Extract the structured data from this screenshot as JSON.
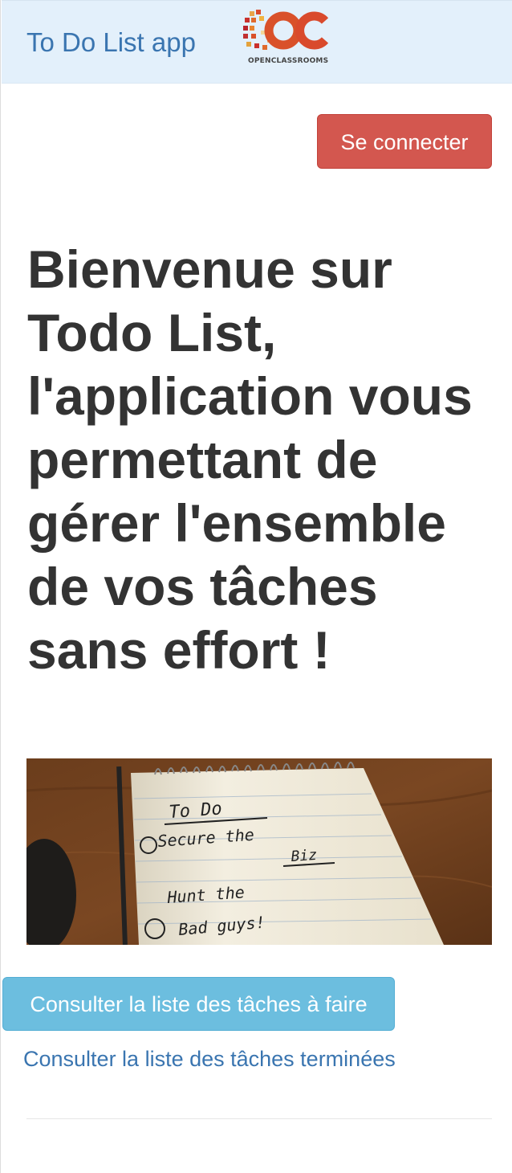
{
  "navbar": {
    "brand": "To Do List app",
    "logo_text": "OPENCLASSROOMS",
    "logo_letters": "OC"
  },
  "header": {
    "login_button": "Se connecter"
  },
  "main": {
    "welcome": "Bienvenue sur Todo List, l'application vous permettant de gérer l'ensemble de vos tâches sans effort !",
    "image": {
      "title": "To Do",
      "item1": "Secure the",
      "item1b": "Biz",
      "item2a": "Hunt the",
      "item2b": "Bad guys!"
    },
    "todo_button": "Consulter la liste des tâches à faire",
    "done_link": "Consulter la liste des tâches terminées"
  },
  "colors": {
    "navbar_bg": "#e3f0fb",
    "brand": "#3a75b0",
    "danger": "#d3574f",
    "info": "#6cbedf"
  }
}
